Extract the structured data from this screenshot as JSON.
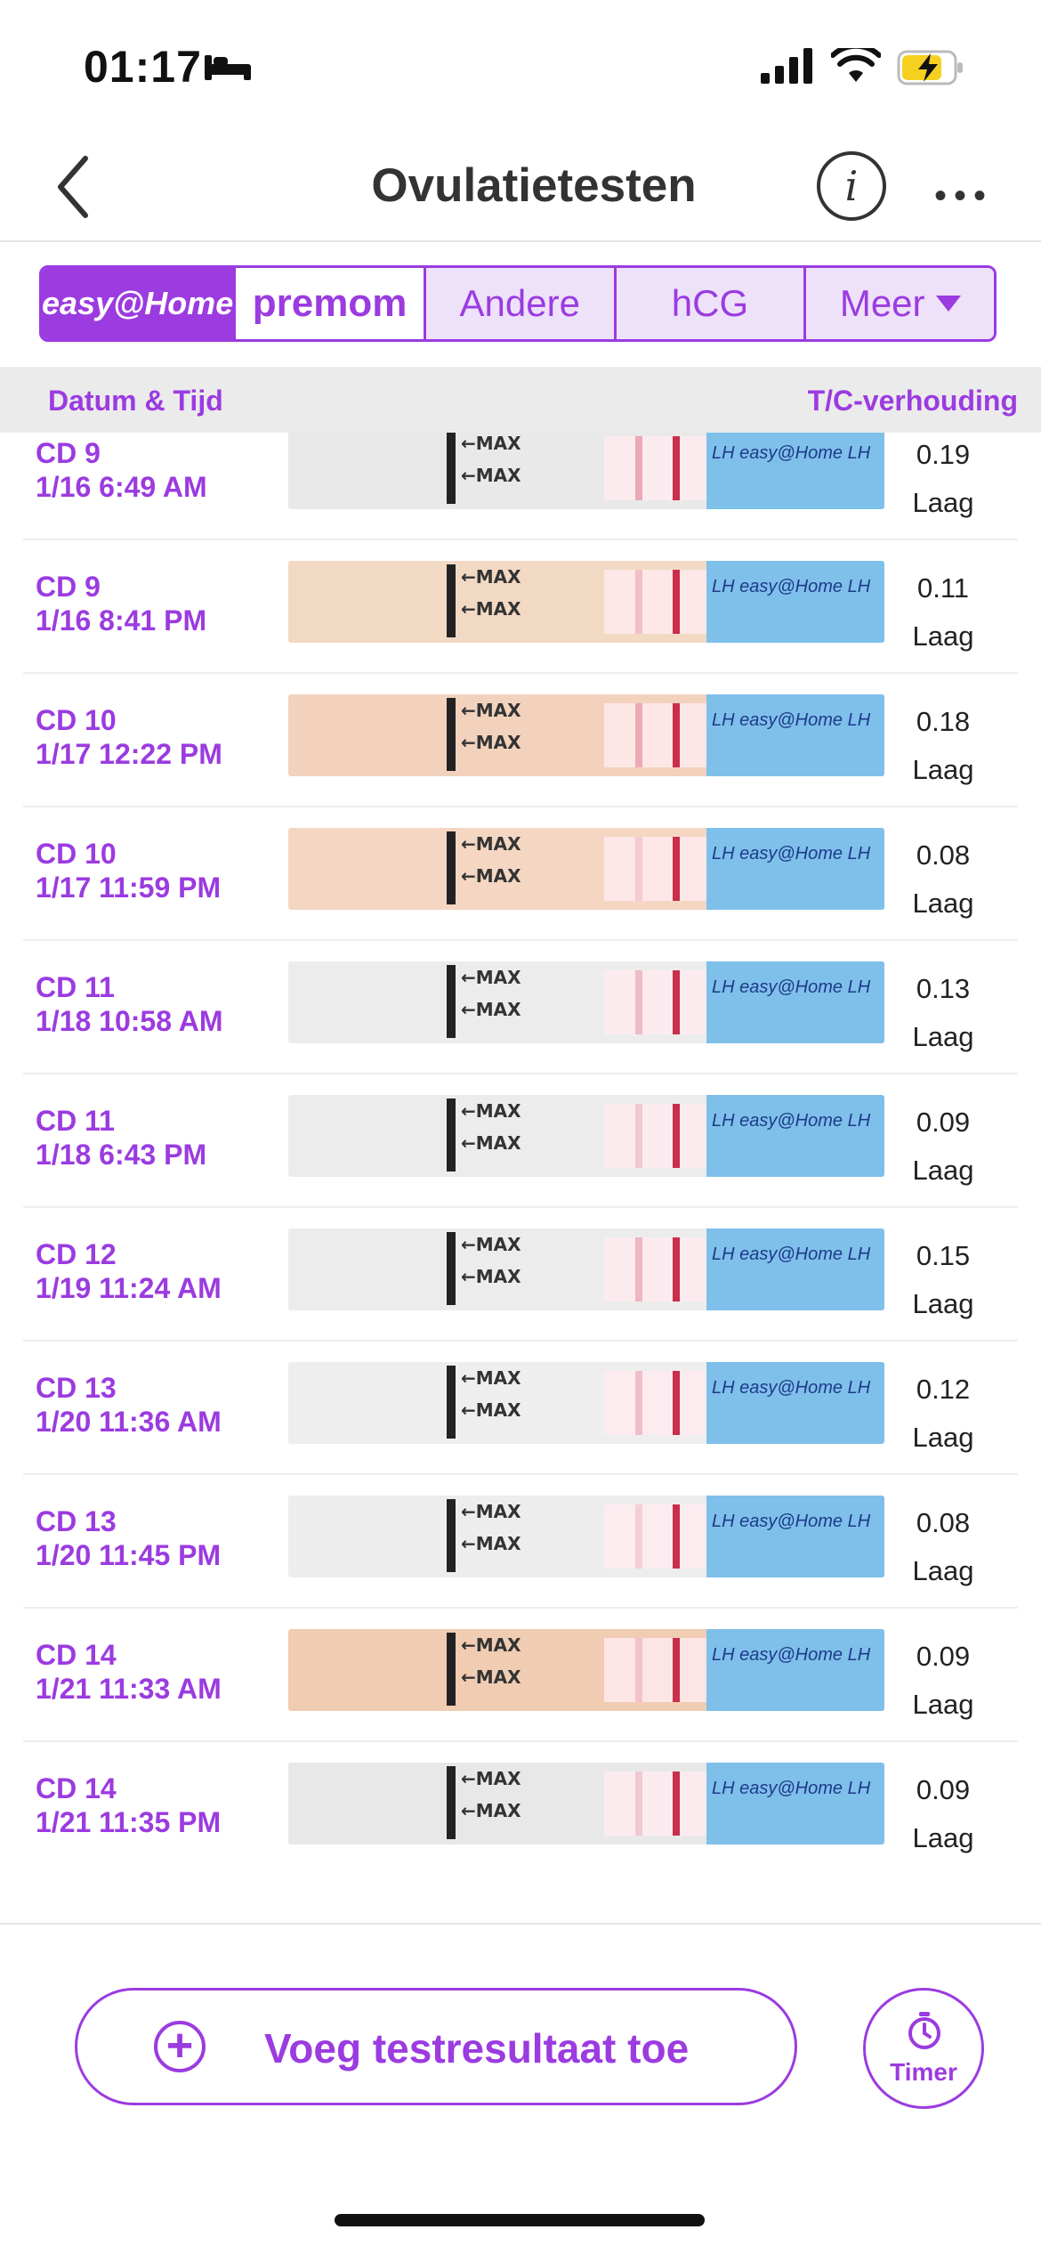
{
  "status_bar": {
    "time": "01:17"
  },
  "nav": {
    "title": "Ovulatietesten"
  },
  "tabs": [
    {
      "label": "easy@Home"
    },
    {
      "label": "premom"
    },
    {
      "label": "Andere"
    },
    {
      "label": "hCG"
    },
    {
      "label": "Meer"
    }
  ],
  "columns": {
    "left": "Datum & Tijd",
    "right": "T/C-verhouding"
  },
  "strip_text": {
    "max": "←MAX",
    "pad": "LH easy@Home LH"
  },
  "results": [
    {
      "cd": "CD 9",
      "datetime": "1/16 6:49 AM",
      "ratio": "0.19",
      "level": "Laag"
    },
    {
      "cd": "CD 9",
      "datetime": "1/16 8:41 PM",
      "ratio": "0.11",
      "level": "Laag"
    },
    {
      "cd": "CD 10",
      "datetime": "1/17 12:22 PM",
      "ratio": "0.18",
      "level": "Laag"
    },
    {
      "cd": "CD 10",
      "datetime": "1/17 11:59 PM",
      "ratio": "0.08",
      "level": "Laag"
    },
    {
      "cd": "CD 11",
      "datetime": "1/18 10:58 AM",
      "ratio": "0.13",
      "level": "Laag"
    },
    {
      "cd": "CD 11",
      "datetime": "1/18 6:43 PM",
      "ratio": "0.09",
      "level": "Laag"
    },
    {
      "cd": "CD 12",
      "datetime": "1/19 11:24 AM",
      "ratio": "0.15",
      "level": "Laag"
    },
    {
      "cd": "CD 13",
      "datetime": "1/20 11:36 AM",
      "ratio": "0.12",
      "level": "Laag"
    },
    {
      "cd": "CD 13",
      "datetime": "1/20 11:45 PM",
      "ratio": "0.08",
      "level": "Laag"
    },
    {
      "cd": "CD 14",
      "datetime": "1/21 11:33 AM",
      "ratio": "0.09",
      "level": "Laag"
    },
    {
      "cd": "CD 14",
      "datetime": "1/21 11:35 PM",
      "ratio": "0.09",
      "level": "Laag"
    }
  ],
  "actions": {
    "add_label": "Voeg testresultaat toe",
    "timer_label": "Timer"
  },
  "colors": {
    "accent": "#9b3be0",
    "control_line": "#c92e4b"
  }
}
